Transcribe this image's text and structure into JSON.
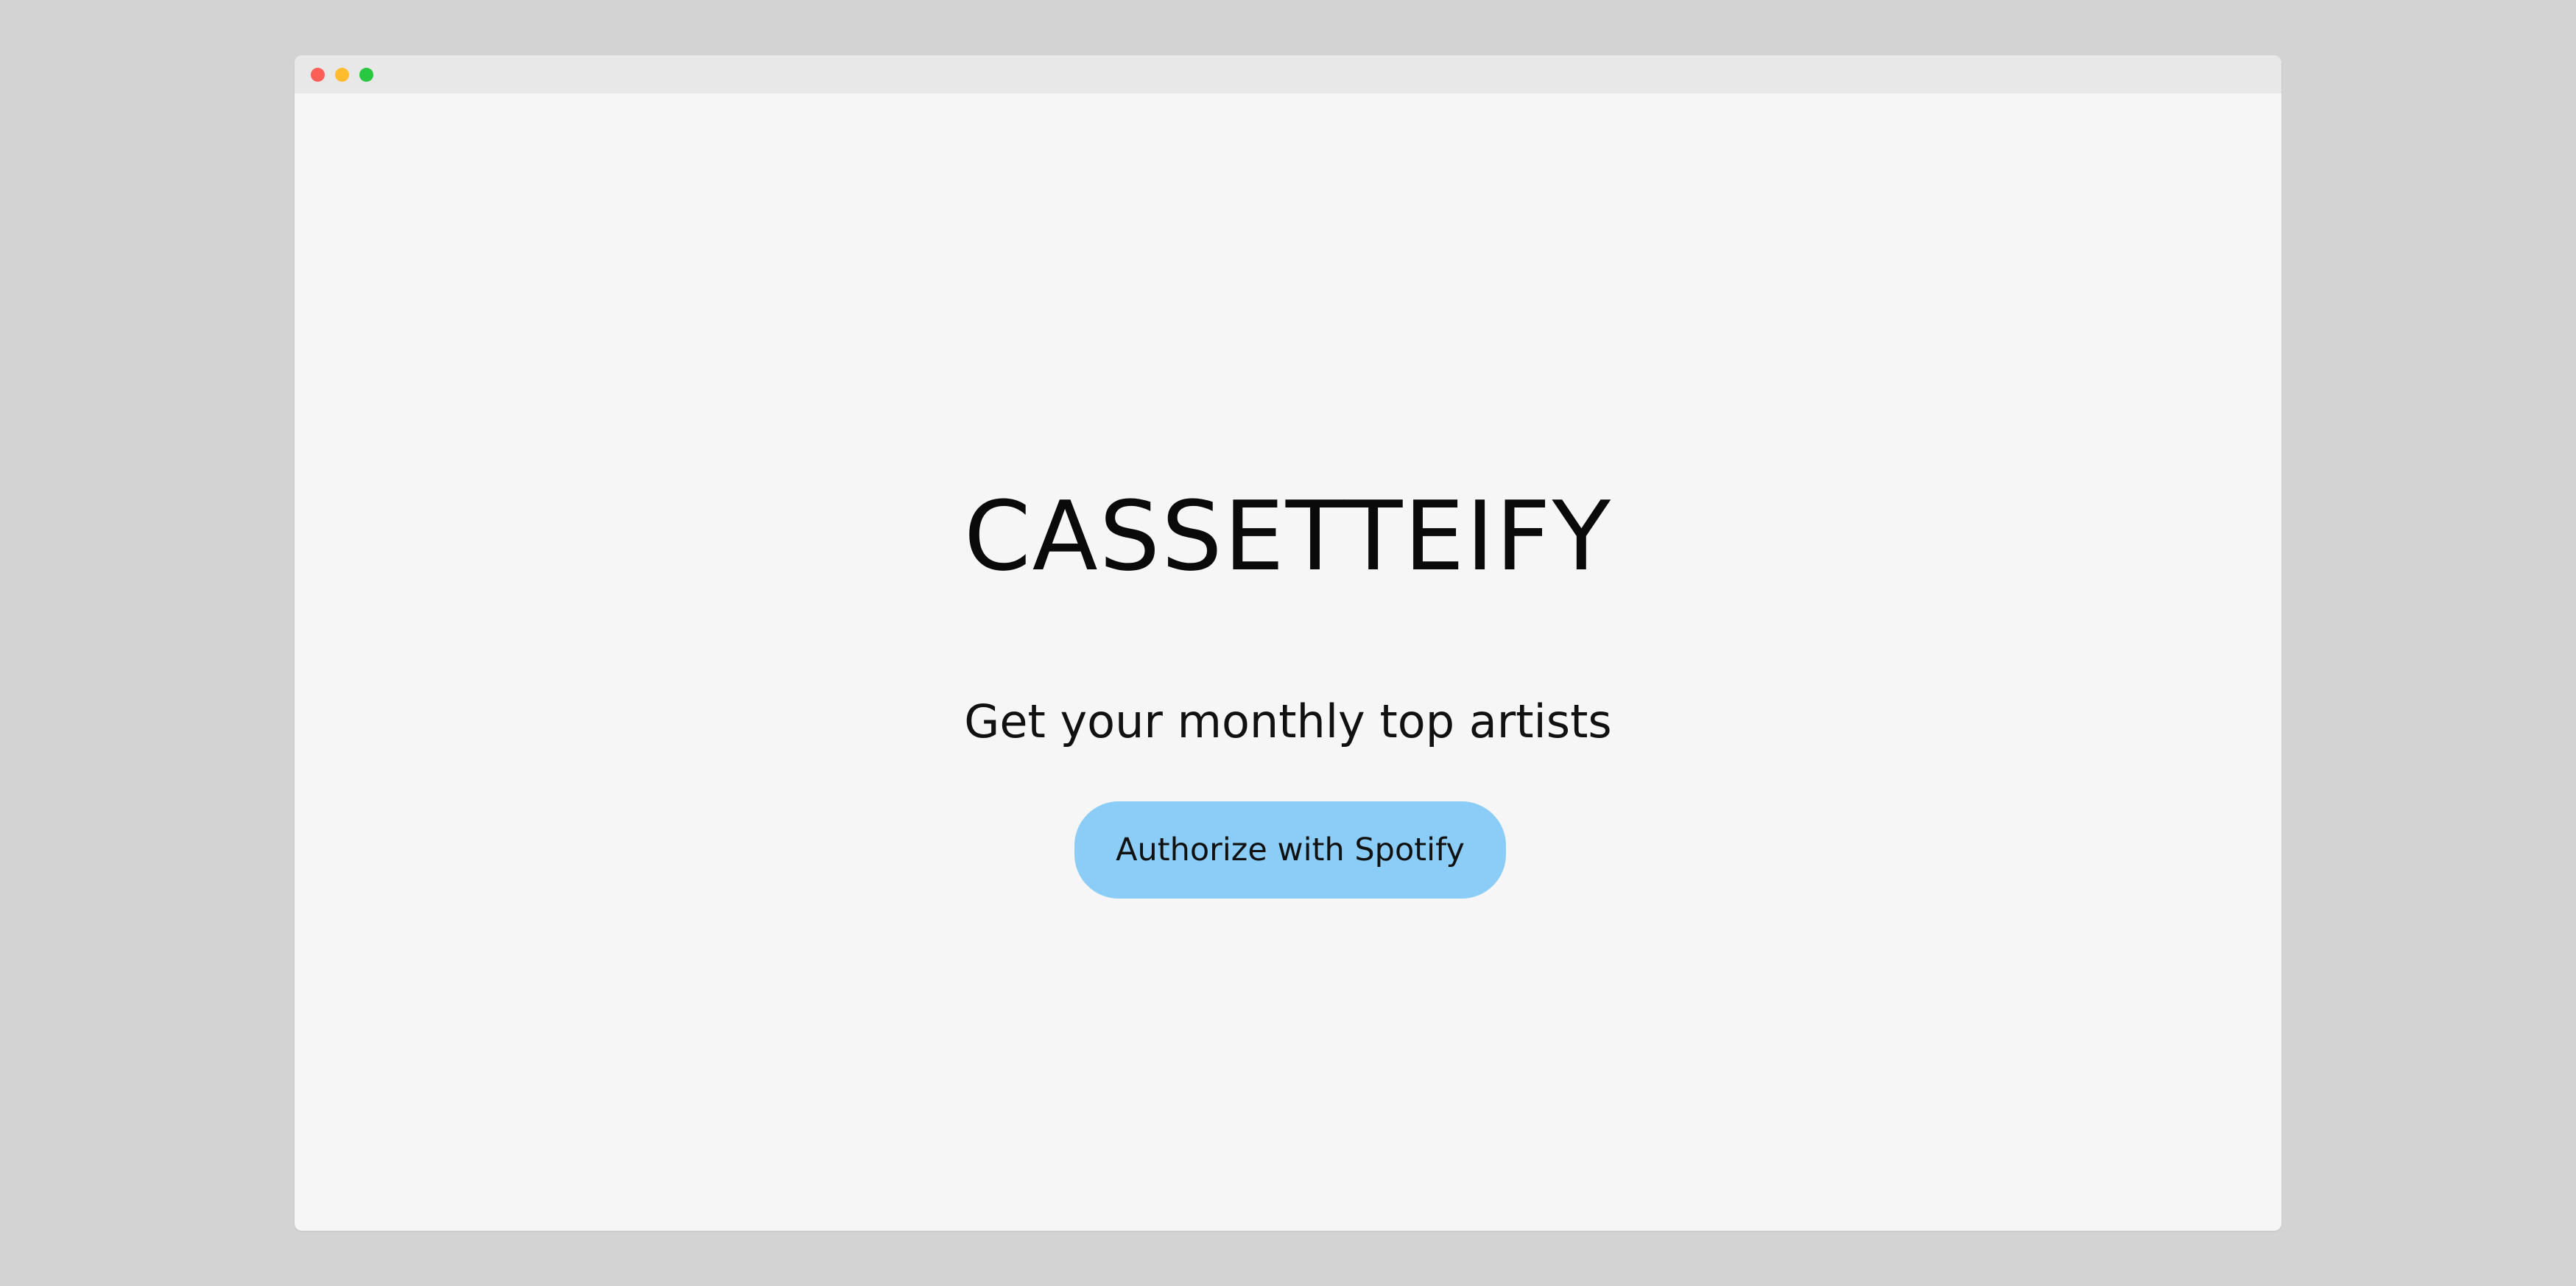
{
  "window": {
    "controls": [
      {
        "name": "close",
        "color": "#fd5f57"
      },
      {
        "name": "minimize",
        "color": "#febc2e"
      },
      {
        "name": "maximize",
        "color": "#28c840"
      }
    ]
  },
  "main": {
    "title": "CASSETTEIFY",
    "tagline": "Get your monthly top artists",
    "auth_button_label": "Authorize with Spotify",
    "auth_button_color": "#8bcdf6"
  }
}
